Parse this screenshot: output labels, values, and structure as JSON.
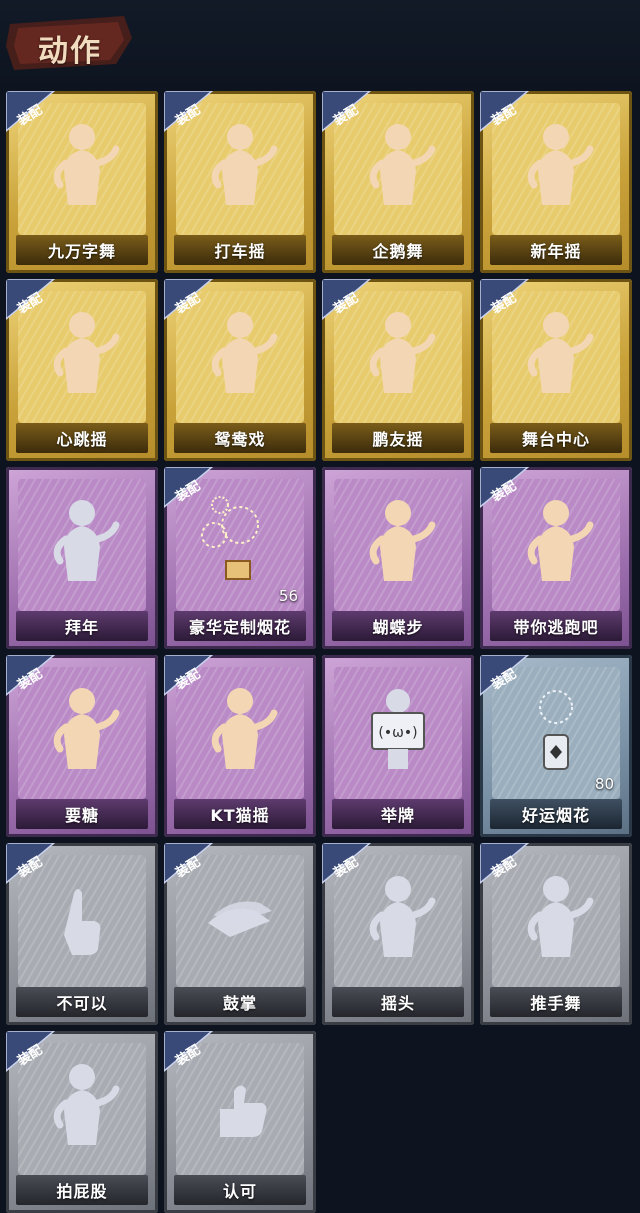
{
  "header": {
    "title": "动作"
  },
  "badge_label": "装配",
  "colors": {
    "gold": "#d4af4a",
    "purple": "#a677b5",
    "blue": "#8199ad",
    "gray": "#9a9da4",
    "badge": "#3a4a78",
    "figure_light": "#f3d7b4",
    "figure_silver": "#d8dbe6"
  },
  "cards": [
    {
      "name": "九万字舞",
      "tier": "gold",
      "equipped": true,
      "icon": "dancer-silhouette-icon"
    },
    {
      "name": "打车摇",
      "tier": "gold",
      "equipped": true,
      "icon": "dancer-silhouette-icon"
    },
    {
      "name": "企鹅舞",
      "tier": "gold",
      "equipped": true,
      "icon": "dancer-silhouette-icon"
    },
    {
      "name": "新年摇",
      "tier": "gold",
      "equipped": true,
      "icon": "dancer-silhouette-icon"
    },
    {
      "name": "心跳摇",
      "tier": "gold",
      "equipped": true,
      "icon": "dancer-silhouette-icon"
    },
    {
      "name": "鸳鸯戏",
      "tier": "gold",
      "equipped": true,
      "icon": "dancer-silhouette-icon"
    },
    {
      "name": "鹏友摇",
      "tier": "gold",
      "equipped": true,
      "icon": "dancer-silhouette-icon"
    },
    {
      "name": "舞台中心",
      "tier": "gold",
      "equipped": true,
      "icon": "dancer-silhouette-icon"
    },
    {
      "name": "拜年",
      "tier": "purple",
      "equipped": false,
      "icon": "bowing-figure-icon"
    },
    {
      "name": "豪华定制烟花",
      "tier": "purple",
      "equipped": true,
      "icon": "fireworks-icon",
      "count": "56"
    },
    {
      "name": "蝴蝶步",
      "tier": "purple",
      "equipped": false,
      "icon": "dancer-silhouette-icon"
    },
    {
      "name": "带你逃跑吧",
      "tier": "purple",
      "equipped": true,
      "icon": "dancer-silhouette-icon"
    },
    {
      "name": "要糖",
      "tier": "purple",
      "equipped": true,
      "icon": "reaching-figure-icon"
    },
    {
      "name": "KT猫摇",
      "tier": "purple",
      "equipped": true,
      "icon": "dancer-silhouette-icon"
    },
    {
      "name": "举牌",
      "tier": "purple",
      "equipped": false,
      "icon": "sign-holding-icon"
    },
    {
      "name": "好运烟花",
      "tier": "blue",
      "equipped": true,
      "icon": "firework-canister-icon",
      "count": "80"
    },
    {
      "name": "不可以",
      "tier": "gray",
      "equipped": true,
      "icon": "finger-wag-icon"
    },
    {
      "name": "鼓掌",
      "tier": "gray",
      "equipped": true,
      "icon": "clapping-hands-icon"
    },
    {
      "name": "摇头",
      "tier": "gray",
      "equipped": true,
      "icon": "head-shake-icon"
    },
    {
      "name": "推手舞",
      "tier": "gray",
      "equipped": true,
      "icon": "push-dance-icon"
    },
    {
      "name": "拍屁股",
      "tier": "gray",
      "equipped": true,
      "icon": "bending-figure-icon"
    },
    {
      "name": "认可",
      "tier": "gray",
      "equipped": true,
      "icon": "thumbs-up-icon"
    }
  ]
}
